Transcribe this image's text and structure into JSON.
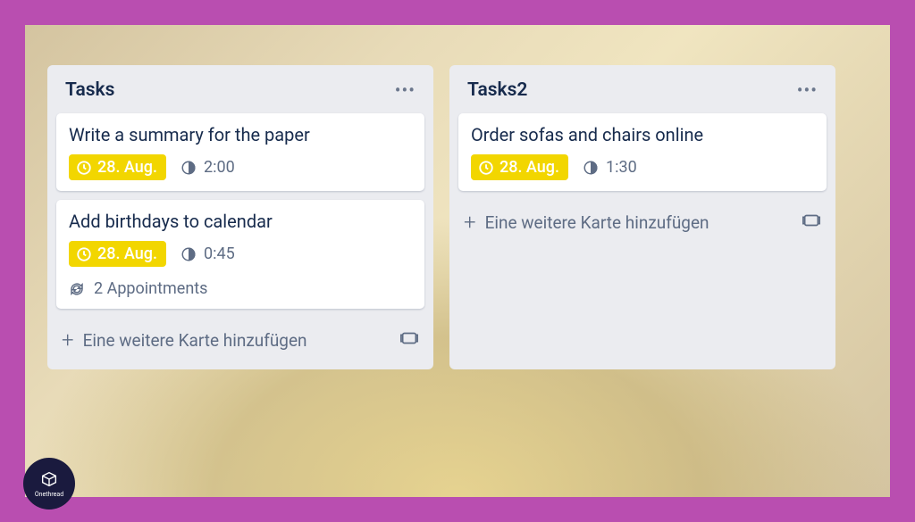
{
  "lists": [
    {
      "title": "Tasks",
      "cards": [
        {
          "title": "Write a summary for the paper",
          "date": "28. Aug.",
          "duration": "2:00",
          "recurring": null
        },
        {
          "title": "Add birthdays to calendar",
          "date": "28. Aug.",
          "duration": "0:45",
          "recurring": "2 Appointments"
        }
      ],
      "addCardLabel": "Eine weitere Karte hinzufügen"
    },
    {
      "title": "Tasks2",
      "cards": [
        {
          "title": "Order sofas and chairs online",
          "date": "28. Aug.",
          "duration": "1:30",
          "recurring": null
        }
      ],
      "addCardLabel": "Eine weitere Karte hinzufügen"
    }
  ],
  "logo": {
    "name": "Onethread"
  }
}
